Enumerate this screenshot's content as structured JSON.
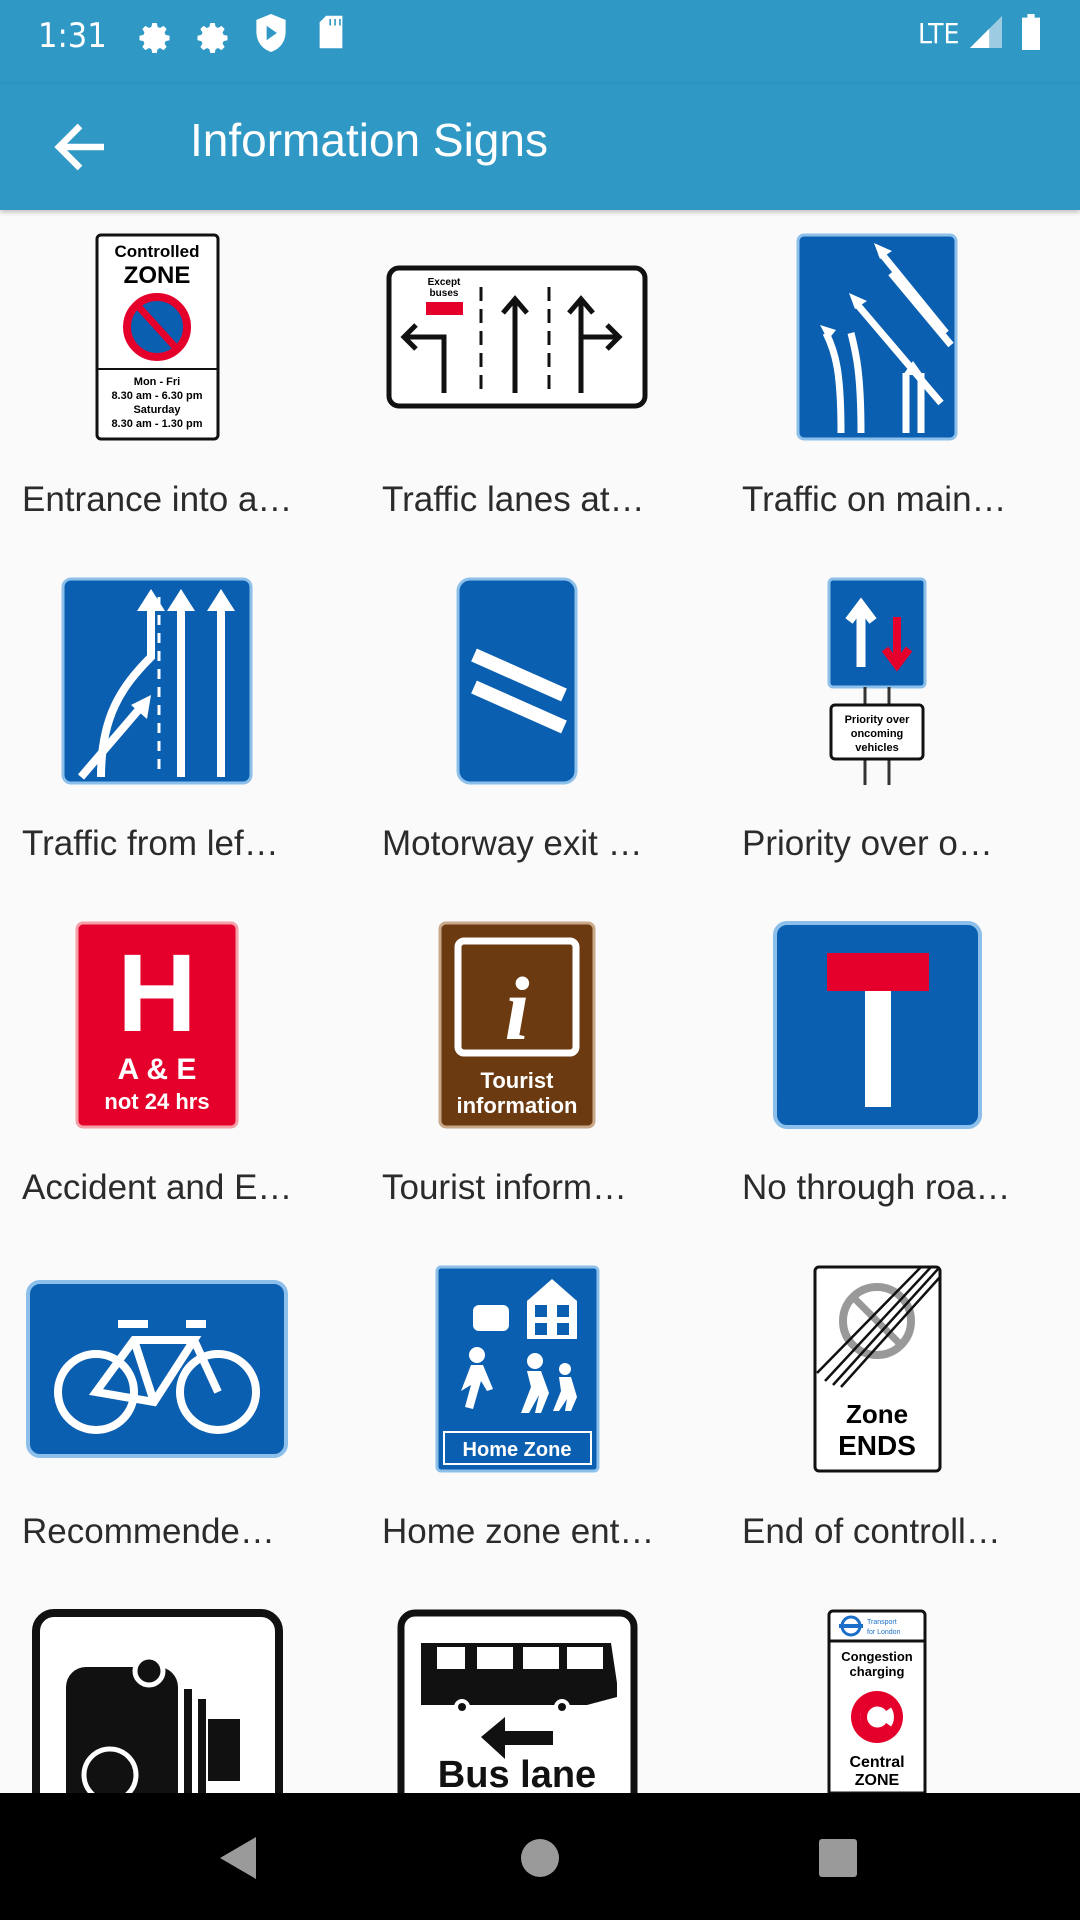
{
  "status_bar": {
    "time": "1:31",
    "network": "LTE",
    "icons": [
      "gear-icon",
      "gear-icon",
      "shield-play-icon",
      "sd-card-icon",
      "signal-icon",
      "battery-icon"
    ]
  },
  "app_bar": {
    "title": "Information Signs",
    "back_icon": "arrow-back-icon",
    "color": "#2f98c4"
  },
  "signs": [
    {
      "label": "Entrance into a…",
      "sign_text": [
        "Controlled",
        "ZONE",
        "Mon - Fri",
        "8.30 am - 6.30 pm",
        "Saturday",
        "8.30 am - 1.30 pm"
      ]
    },
    {
      "label": "Traffic lanes at…",
      "sign_text": [
        "Except",
        "buses"
      ]
    },
    {
      "label": "Traffic on main…"
    },
    {
      "label": "Traffic from lef…"
    },
    {
      "label": "Motorway exit …"
    },
    {
      "label": "Priority over o…",
      "sign_text": [
        "Priority over",
        "oncoming",
        "vehicles"
      ]
    },
    {
      "label": "Accident and E…",
      "sign_text": [
        "H",
        "A & E",
        "not 24 hrs"
      ]
    },
    {
      "label": "Tourist inform…",
      "sign_text": [
        "i",
        "Tourist",
        "information"
      ]
    },
    {
      "label": "No through roa…"
    },
    {
      "label": "Recommende…"
    },
    {
      "label": "Home zone ent…",
      "sign_text": [
        "Home Zone"
      ]
    },
    {
      "label": "End of controll…",
      "sign_text": [
        "Zone",
        "ENDS"
      ]
    },
    {
      "label": ""
    },
    {
      "label": "",
      "sign_text": [
        "Bus lane"
      ]
    },
    {
      "label": "",
      "sign_text": [
        "Transport",
        "for London",
        "Congestion",
        "charging",
        "Central",
        "ZONE"
      ]
    }
  ],
  "colors": {
    "sign_blue": "#0b5fb0",
    "sign_red": "#e4002b",
    "sign_brown": "#6b3a10",
    "background": "#fafafa"
  }
}
